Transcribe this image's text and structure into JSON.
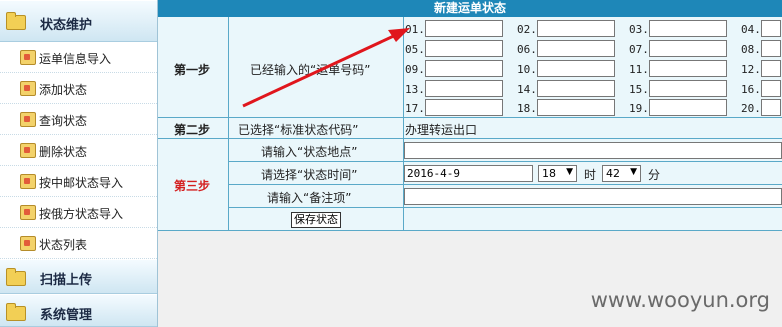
{
  "sidebar": {
    "sections": [
      {
        "label": "状态维护"
      },
      {
        "label": "扫描上传"
      },
      {
        "label": "系统管理"
      }
    ],
    "items": [
      {
        "label": "运单信息导入"
      },
      {
        "label": "添加状态"
      },
      {
        "label": "查询状态"
      },
      {
        "label": "删除状态"
      },
      {
        "label": "按中邮状态导入"
      },
      {
        "label": "按俄方状态导入"
      },
      {
        "label": "状态列表"
      }
    ]
  },
  "form": {
    "title": "新建运单状态",
    "step1": {
      "label": "第一步",
      "desc": "已经输入的“运单号码”"
    },
    "step2": {
      "label": "第二步",
      "desc": "已选择“标准状态代码”",
      "value": "办理转运出口"
    },
    "step3": {
      "label": "第三步",
      "location_label": "请输入“状态地点”",
      "time_label": "请选择“状态时间”",
      "date_value": "2016-4-9",
      "hour_value": "18",
      "hour_unit": "时",
      "minute_value": "42",
      "minute_unit": "分",
      "remark_label": "请输入“备注项”",
      "save_label": "保存状态"
    },
    "tracking_numbers": [
      "01.",
      "02.",
      "03.",
      "04.",
      "05.",
      "06.",
      "07.",
      "08.",
      "09.",
      "10.",
      "11.",
      "12.",
      "13.",
      "14.",
      "15.",
      "16.",
      "17.",
      "18.",
      "19.",
      "20."
    ]
  },
  "watermark": "www.wooyun.org",
  "colors": {
    "title_bg": "#1e87b8",
    "arrow": "#e0161c",
    "step3": "#d42020"
  }
}
